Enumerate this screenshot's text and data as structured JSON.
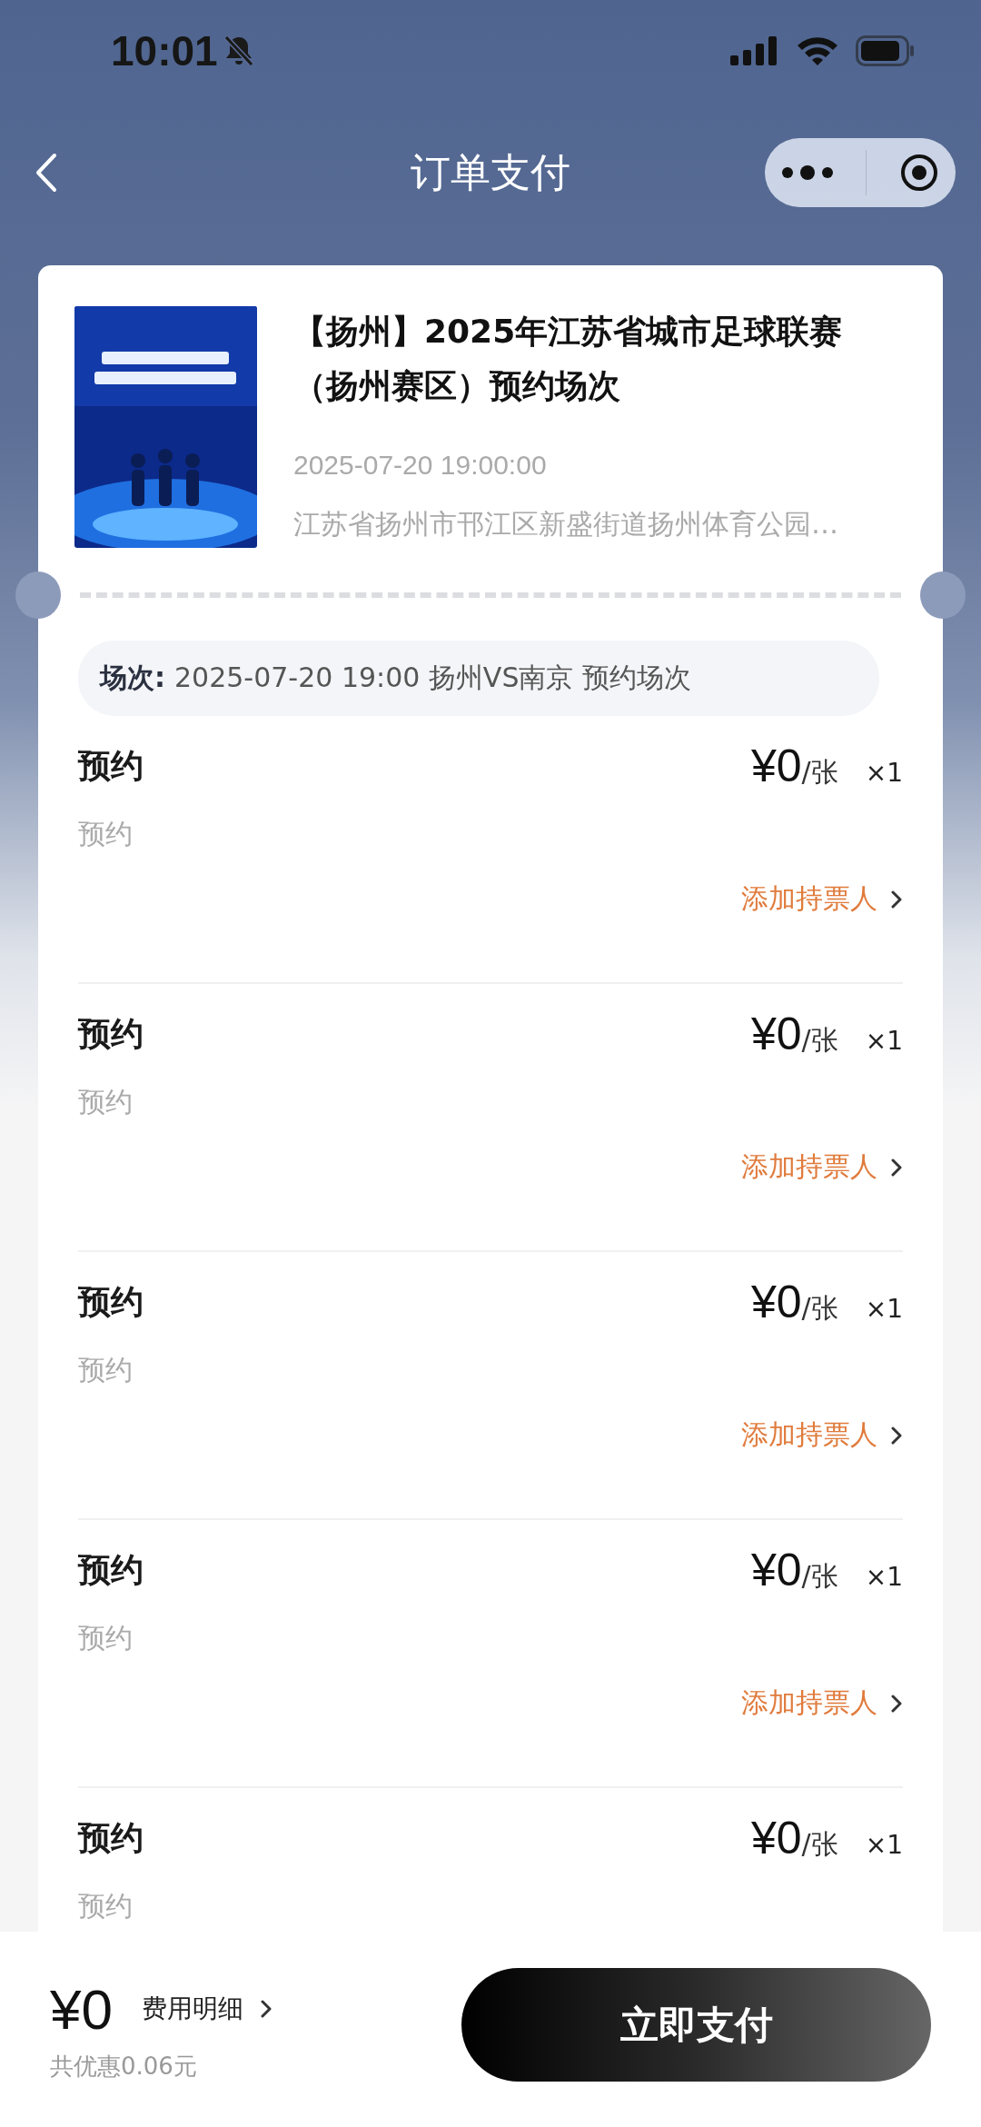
{
  "status_bar": {
    "time": "10:01"
  },
  "nav": {
    "title": "订单支付"
  },
  "event": {
    "title": "【扬州】2025年江苏省城市足球联赛（扬州赛区）预约场次",
    "datetime": "2025-07-20 19:00:00",
    "address": "江苏省扬州市邗江区新盛街道扬州体育公园…"
  },
  "session": {
    "label": "场次:",
    "value": "2025-07-20 19:00 扬州VS南京 预约场次"
  },
  "tickets": [
    {
      "name": "预约",
      "desc": "预约",
      "price": "¥0",
      "unit": "/张",
      "qty": "×1",
      "action": "添加持票人"
    },
    {
      "name": "预约",
      "desc": "预约",
      "price": "¥0",
      "unit": "/张",
      "qty": "×1",
      "action": "添加持票人"
    },
    {
      "name": "预约",
      "desc": "预约",
      "price": "¥0",
      "unit": "/张",
      "qty": "×1",
      "action": "添加持票人"
    },
    {
      "name": "预约",
      "desc": "预约",
      "price": "¥0",
      "unit": "/张",
      "qty": "×1",
      "action": "添加持票人"
    },
    {
      "name": "预约",
      "desc": "预约",
      "price": "¥0",
      "unit": "/张",
      "qty": "×1"
    }
  ],
  "footer": {
    "total": "¥0",
    "detail_link": "费用明细",
    "discount": "共优惠0.06元",
    "pay_button": "立即支付"
  }
}
